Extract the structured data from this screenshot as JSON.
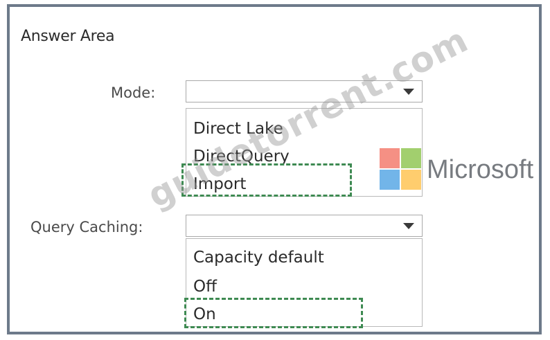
{
  "answer_area": {
    "title": "Answer Area"
  },
  "mode": {
    "label": "Mode:",
    "selected_value": "",
    "options": [
      "Direct Lake",
      "DirectQuery",
      "Import"
    ],
    "highlighted_option": "Import"
  },
  "query_caching": {
    "label": "Query Caching:",
    "selected_value": "",
    "options": [
      "Capacity default",
      "Off",
      "On"
    ],
    "highlighted_option": "On"
  },
  "branding": {
    "logo_text": "Microsoft",
    "logo_icon": "microsoft-logo-icon",
    "watermark": "guidetorrent.com"
  },
  "colors": {
    "frame_border": "#6d7a8a",
    "selection_dash": "#3e8a52"
  }
}
